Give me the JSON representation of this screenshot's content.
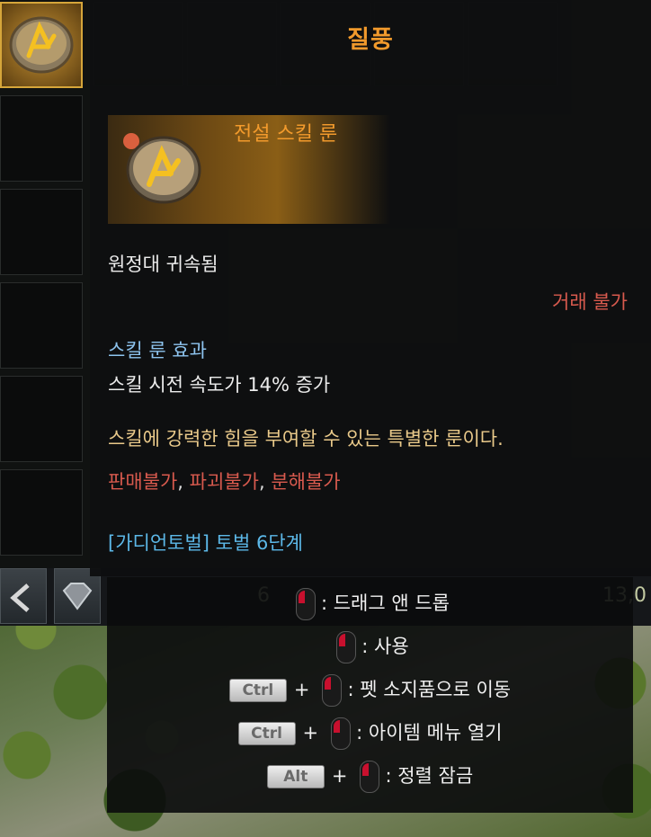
{
  "item": {
    "name": "질풍",
    "grade": "전설 스킬 룬",
    "binding": "원정대 귀속됨",
    "trade": "거래 불가",
    "effect_header": "스킬 룬 효과",
    "effect": "스킬 시전 속도가 14% 증가",
    "description": "스킬에 강력한 힘을 부여할 수 있는 특별한 룬이다.",
    "restrictions": [
      "판매불가",
      "파괴불가",
      "분해불가"
    ],
    "separator": ",",
    "guardian": "[가디언토벌] 토벌 6단계",
    "colors": {
      "title": "#f29a2c",
      "warning": "#d85a4e",
      "effect_header": "#8ec4ef",
      "description": "#e9c98a",
      "guardian": "#5cb8e8"
    }
  },
  "bar": {
    "left_value": "6",
    "right_value": "13,0"
  },
  "controls": [
    {
      "key": "",
      "action": ": 드래그 앤 드롭"
    },
    {
      "key": "",
      "action": ": 사용"
    },
    {
      "key": "Ctrl",
      "plus": "+",
      "action": ": 펫 소지품으로 이동"
    },
    {
      "key": "Ctrl",
      "plus": "+",
      "action": ": 아이템 메뉴 열기"
    },
    {
      "key": "Alt",
      "plus": "+",
      "action": ": 정렬 잠금"
    }
  ]
}
